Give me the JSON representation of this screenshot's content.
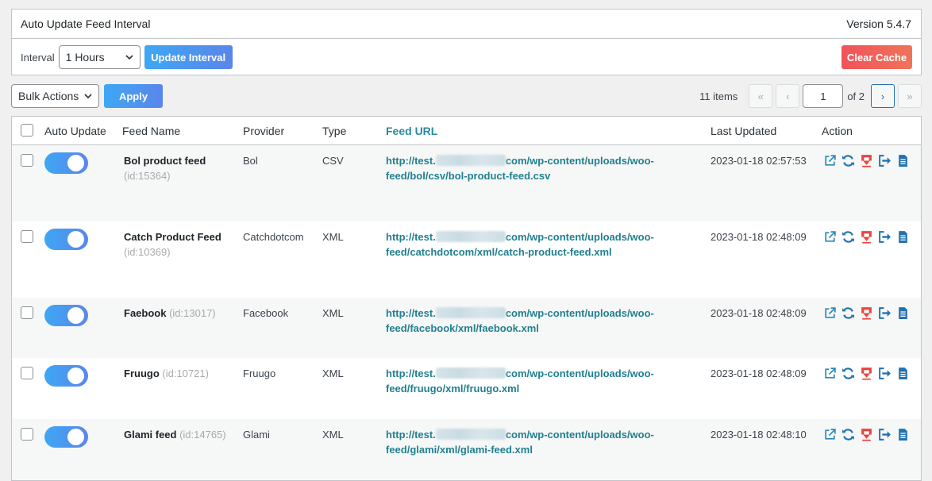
{
  "panel": {
    "title": "Auto Update Feed Interval",
    "version": "Version 5.4.7",
    "interval_label": "Interval",
    "interval_value": "1 Hours",
    "update_button": "Update Interval",
    "clear_cache_button": "Clear Cache"
  },
  "toolbar": {
    "bulk_actions": "Bulk Actions",
    "apply_button": "Apply",
    "items_count": "11 items",
    "first_page": "«",
    "prev_page": "‹",
    "current_page": "1",
    "of_pages": "of 2",
    "next_page": "›",
    "last_page": "»"
  },
  "table": {
    "headers": {
      "auto_update": "Auto Update",
      "feed_name": "Feed Name",
      "provider": "Provider",
      "type": "Type",
      "feed_url": "Feed URL",
      "last_updated": "Last Updated",
      "action": "Action"
    },
    "rows": [
      {
        "name": "Bol product feed",
        "id": "(id:15364)",
        "provider": "Bol",
        "type": "CSV",
        "url_start": "http://test.",
        "url_rest": "com/wp-content/uploads/woo-",
        "url_line2": "feed/bol/csv/bol-product-feed.csv",
        "updated": "2023-01-18 02:57:53",
        "auto_update": true
      },
      {
        "name": "Catch Product Feed",
        "id": "(id:10369)",
        "provider": "Catchdotcom",
        "type": "XML",
        "url_start": "http://test.",
        "url_rest": "com/wp-content/uploads/woo-",
        "url_line2": "feed/catchdotcom/xml/catch-product-feed.xml",
        "updated": "2023-01-18 02:48:09",
        "auto_update": true
      },
      {
        "name": "Faebook",
        "id": "(id:13017)",
        "provider": "Facebook",
        "type": "XML",
        "url_start": "http://test.",
        "url_rest": "com/wp-content/uploads/woo-",
        "url_line2": "feed/facebook/xml/faebook.xml",
        "updated": "2023-01-18 02:48:09",
        "auto_update": true
      },
      {
        "name": "Fruugo",
        "id": "(id:10721)",
        "provider": "Fruugo",
        "type": "XML",
        "url_start": "http://test.",
        "url_rest": "com/wp-content/uploads/woo-",
        "url_line2": "feed/fruugo/xml/fruugo.xml",
        "updated": "2023-01-18 02:48:09",
        "auto_update": true
      },
      {
        "name": "Glami feed",
        "id": "(id:14765)",
        "provider": "Glami",
        "type": "XML",
        "url_start": "http://test.",
        "url_rest": "com/wp-content/uploads/woo-",
        "url_line2": "feed/glami/xml/glami-feed.xml",
        "updated": "2023-01-18 02:48:10",
        "auto_update": true
      }
    ]
  },
  "colors": {
    "accent_blue": "#3ea7f4",
    "danger_red": "#f0535a",
    "url_teal": "#21808f"
  },
  "icons": [
    "external-link-icon",
    "refresh-icon",
    "download-icon",
    "export-icon",
    "document-icon"
  ]
}
